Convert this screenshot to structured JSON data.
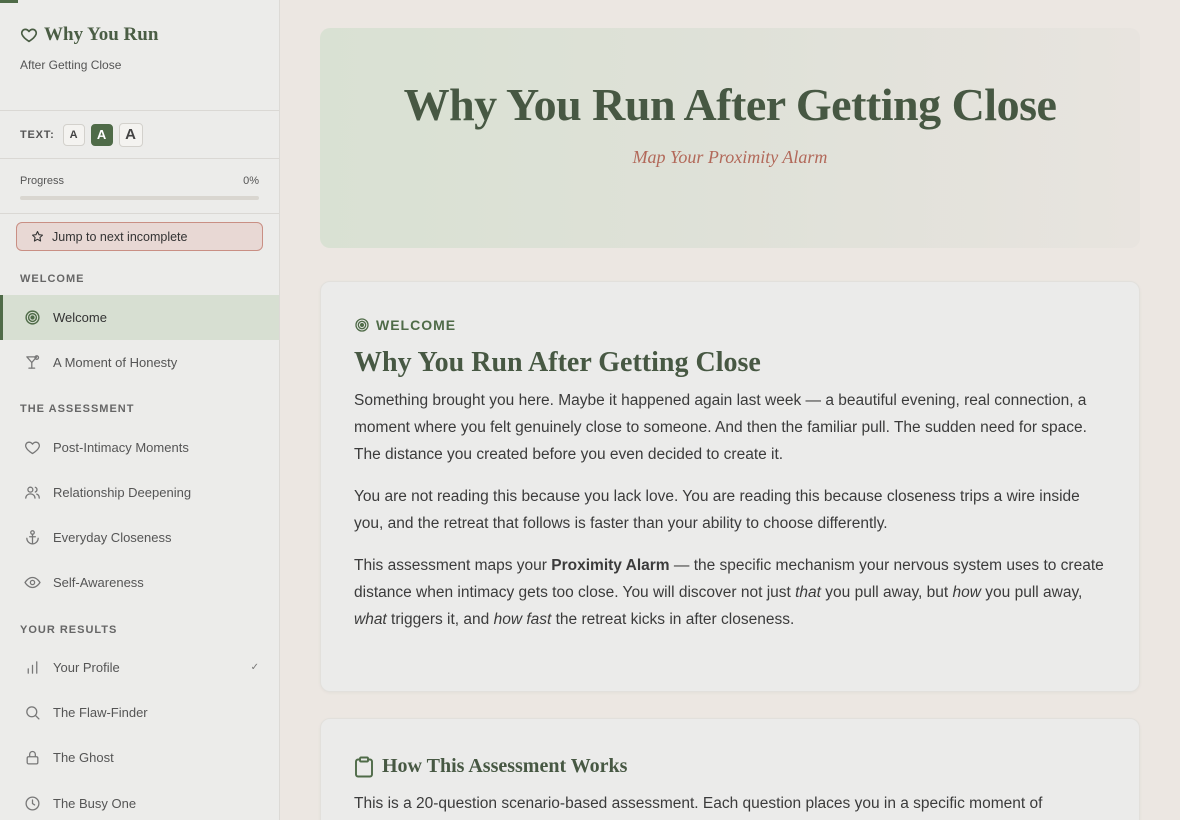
{
  "sidebar": {
    "brand_title": "Why You Run",
    "brand_subtitle": "After Getting Close",
    "text_size_label": "TEXT:",
    "text_size_options": [
      "A",
      "A",
      "A"
    ],
    "progress_label": "Progress",
    "progress_value": "0%",
    "progress_fraction": 0,
    "jump_label": "Jump to next incomplete",
    "sections": [
      {
        "title": "WELCOME",
        "items": [
          {
            "label": "Welcome",
            "icon": "target-icon",
            "active": true
          },
          {
            "label": "A Moment of Honesty",
            "icon": "cocktail-icon"
          }
        ]
      },
      {
        "title": "THE ASSESSMENT",
        "items": [
          {
            "label": "Post-Intimacy Moments",
            "icon": "heart-icon"
          },
          {
            "label": "Relationship Deepening",
            "icon": "users-icon"
          },
          {
            "label": "Everyday Closeness",
            "icon": "anchor-icon"
          },
          {
            "label": "Self-Awareness",
            "icon": "eye-icon"
          }
        ]
      },
      {
        "title": "YOUR RESULTS",
        "items": [
          {
            "label": "Your Profile",
            "icon": "bar-chart-icon",
            "check": "✓"
          },
          {
            "label": "The Flaw-Finder",
            "icon": "search-icon"
          },
          {
            "label": "The Ghost",
            "icon": "lock-icon"
          },
          {
            "label": "The Busy One",
            "icon": "clock-icon"
          }
        ]
      }
    ]
  },
  "hero": {
    "title": "Why You Run After Getting Close",
    "subtitle": "Map Your Proximity Alarm"
  },
  "welcome_card": {
    "eyebrow": "WELCOME",
    "title": "Why You Run After Getting Close",
    "para1": "Something brought you here. Maybe it happened again last week — a beautiful evening, real connection, a moment where you felt genuinely close to someone. And then the familiar pull. The sudden need for space. The distance you created before you even decided to create it.",
    "para2": "You are not reading this because you lack love. You are reading this because closeness trips a wire inside you, and the retreat that follows is faster than your ability to choose differently.",
    "para3": {
      "t1": "This assessment maps your ",
      "b1": "Proximity Alarm",
      "t2": " — the specific mechanism your nervous system uses to create distance when intimacy gets too close. You will discover not just ",
      "i1": "that",
      "t3": " you pull away, but ",
      "i2": "how",
      "t4": " you pull away, ",
      "i3": "what",
      "t5": " triggers it, and ",
      "i4": "how fast",
      "t6": " the retreat kicks in after closeness."
    }
  },
  "how_card": {
    "title": "How This Assessment Works",
    "text": "This is a 20-question scenario-based assessment. Each question places you in a specific moment of"
  },
  "colors": {
    "accent": "#4f6b48",
    "hero_subtitle": "#b2695a",
    "jump_border": "#c98f84"
  }
}
